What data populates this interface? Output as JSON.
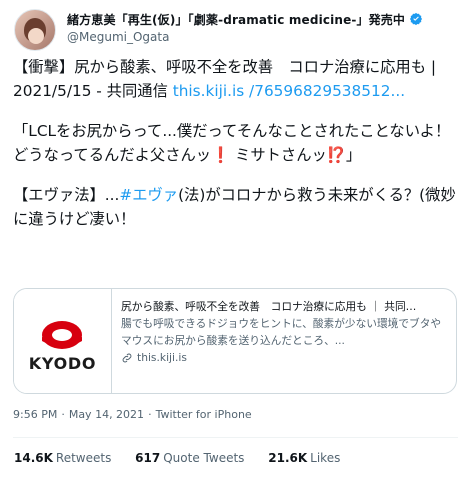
{
  "user": {
    "display_name": "緒方恵美「再生(仮)」「劇薬-dramatic medicine-」発売中",
    "handle": "@Megumi_Ogata",
    "verified": true
  },
  "tweet": {
    "line1_prefix": "【衝撃】尻から酸素、呼吸不全を改善　コロナ治療に応用も | 2021/5/15 - 共同通信 ",
    "line1_link": "this.kiji.is /76596829538512...",
    "para2": "「LCLをお尻からって...僕だってそんなことされたことないよ！どうなってるんだよ父さんッ",
    "para2_emoji1": "❗",
    "para2_mid": " ミサトさんッ",
    "para2_emoji2": "⁉️",
    "para2_end": "」",
    "para3_prefix": "【エヴァ法】...",
    "para3_hashtag": "#エヴァ",
    "para3_suffix": "(法)がコロナから救う未来がくる？(微妙に違うけど凄い！"
  },
  "card": {
    "logo_text": "KYODO",
    "title": "尻から酸素、呼吸不全を改善　コロナ治療に応用も ｜ 共同…",
    "description": "腸でも呼吸できるドジョウをヒントに、酸素が少ない環境でブタやマウスにお尻から酸素を送り込んだところ、...",
    "domain": "this.kiji.is"
  },
  "meta": {
    "time": "9:56 PM",
    "date": "May 14, 2021",
    "client": "Twitter for iPhone"
  },
  "stats": {
    "retweets_value": "14.6K",
    "retweets_label": "Retweets",
    "quotes_value": "617",
    "quotes_label": "Quote Tweets",
    "likes_value": "21.6K",
    "likes_label": "Likes"
  },
  "colors": {
    "link": "#1d9bf0",
    "verified": "#1d9bf0",
    "kyodo_red": "#d7000f"
  }
}
